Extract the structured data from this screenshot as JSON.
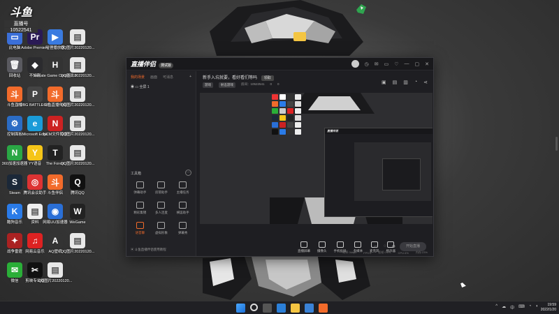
{
  "desktop_icons": [
    {
      "label": "此电脑",
      "color": "#3b6fd8",
      "glyph": "▭"
    },
    {
      "label": "Adobe Premiere",
      "color": "#2a1a55",
      "glyph": "Pr"
    },
    {
      "label": "哈狸播放器",
      "color": "#3a7be0",
      "glyph": "▶"
    },
    {
      "label": "QQ图片20220120...",
      "color": "#e8e8e8",
      "glyph": "▤"
    },
    {
      "label": "回收站",
      "color": "#5a5a60",
      "glyph": "🗑"
    },
    {
      "label": "不知刚",
      "color": "#2b2b2e",
      "glyph": "◆"
    },
    {
      "label": "Hecate Game Center 2.0",
      "color": "#333",
      "glyph": "H"
    },
    {
      "label": "QQ图片20220120...",
      "color": "#e8e8e8",
      "glyph": "▤"
    },
    {
      "label": "斗鱼直播",
      "color": "#f26b2b",
      "glyph": "斗"
    },
    {
      "label": "PUBG BATTLEGR...",
      "color": "#444",
      "glyph": "P"
    },
    {
      "label": "斗鱼直播伴侣",
      "color": "#f26b2b",
      "glyph": "斗"
    },
    {
      "label": "QQ图片20220120...",
      "color": "#e8e8e8",
      "glyph": "▤"
    },
    {
      "label": "控制面板",
      "color": "#2b6cc4",
      "glyph": "⚙"
    },
    {
      "label": "Microsoft Edge",
      "color": "#1a9bd8",
      "glyph": "e"
    },
    {
      "label": "NCM文件转换",
      "color": "#c22",
      "glyph": "N"
    },
    {
      "label": "QQ图片20220120...",
      "color": "#e8e8e8",
      "glyph": "▤"
    },
    {
      "label": "360加速加速器",
      "color": "#2aa745",
      "glyph": "N"
    },
    {
      "label": "YY语音",
      "color": "#f5c518",
      "glyph": "Y"
    },
    {
      "label": "The Forest",
      "color": "#222",
      "glyph": "T"
    },
    {
      "label": "QQ图片20220120...",
      "color": "#e8e8e8",
      "glyph": "▤"
    },
    {
      "label": "Steam",
      "color": "#1b2838",
      "glyph": "S"
    },
    {
      "label": "腾讯会议助手",
      "color": "#d33",
      "glyph": "◎"
    },
    {
      "label": "斗鱼伴侣",
      "color": "#f26b2b",
      "glyph": "斗"
    },
    {
      "label": "腾讯QQ",
      "color": "#111",
      "glyph": "Q"
    },
    {
      "label": "酷狗音乐",
      "color": "#2a7be8",
      "glyph": "K"
    },
    {
      "label": "资料",
      "color": "#eee",
      "glyph": "▤"
    },
    {
      "label": "网易UU加速器",
      "color": "#2a6fd6",
      "glyph": "◉"
    },
    {
      "label": "WeGame",
      "color": "#222",
      "glyph": "W"
    },
    {
      "label": "战争雷霆",
      "color": "#a22",
      "glyph": "✦"
    },
    {
      "label": "网易云音乐",
      "color": "#d22",
      "glyph": "♫"
    },
    {
      "label": "AQ壁纸",
      "color": "#333",
      "glyph": "A"
    },
    {
      "label": "QQ图片20220120...",
      "color": "#e8e8e8",
      "glyph": "▤"
    },
    {
      "label": "微信",
      "color": "#2aae38",
      "glyph": "✉"
    },
    {
      "label": "剪映专业版",
      "color": "#111",
      "glyph": "✂"
    },
    {
      "label": "QQ图片20220120...",
      "color": "#e8e8e8",
      "glyph": "▤"
    }
  ],
  "watermark": {
    "line1": "直播号",
    "line2": "10522541"
  },
  "app": {
    "title": "直播伴侣",
    "title_tag": "测试版",
    "titlebar_buttons": [
      "◷",
      "✉",
      "▭",
      "♡",
      "—",
      "▢",
      "✕"
    ],
    "left_tabs": [
      "我的场景",
      "画面",
      "可消息"
    ],
    "scene_name": "全屏 1",
    "tools_title": "工具箱",
    "tools": [
      {
        "label": "弹幕助手",
        "active": false
      },
      {
        "label": "房管助手",
        "active": false
      },
      {
        "label": "主播任务",
        "active": false
      },
      {
        "label": "精彩集锦",
        "active": false
      },
      {
        "label": "多人连麦",
        "active": false
      },
      {
        "label": "横竖助手",
        "active": false
      },
      {
        "label": "语音聊",
        "active": true
      },
      {
        "label": "虚拟形象",
        "active": false
      },
      {
        "label": "弹幕秀",
        "active": false
      }
    ],
    "left_bottom": "斗鱼直播伴侣使用教程",
    "notice_text": "新手入坑就要，看好看们等吗",
    "notice_button": "领取",
    "meta": {
      "chip1": "游戏",
      "chip2": "射击游戏",
      "room": "房间：10522541",
      "fans": "0",
      "hot": "0"
    },
    "controls": [
      "直播屏幕",
      "摄像头",
      "手机投屏",
      "多媒体",
      "麦克风",
      "扬声器"
    ],
    "start_label": "开始直播",
    "status": [
      "码率 0kbps",
      "FPS:0",
      "丢帧 0.0%",
      "CPU:4%",
      "内存:23%"
    ]
  },
  "taskbar": {
    "tray": [
      "^",
      "☁",
      "中",
      "⌨"
    ],
    "time": "19:59",
    "date": "2022/1/20"
  }
}
